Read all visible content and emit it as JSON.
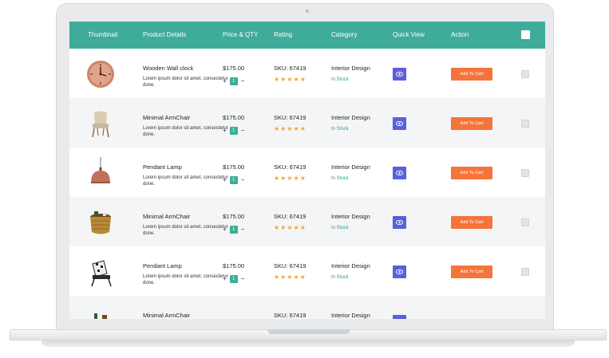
{
  "header": {
    "thumbnail": "Thumbnail",
    "product_details": "Product Details",
    "price_qty": "Price & QTY",
    "rating": "Rating",
    "category": "Category",
    "quick_view": "Quick View",
    "action": "Action"
  },
  "rows": [
    {
      "name": "Wooden Wall clock",
      "desc": "Lorem ipsum dolor sit amet, consectetur done.",
      "price": "$175.00",
      "qty": "1",
      "sku": "SKU: 67419",
      "stars": "★★★★★",
      "category": "Interior Design",
      "stock": "In Stock",
      "cart": "Add To Cart",
      "thumb_icon": "wall-clock-icon"
    },
    {
      "name": "Minimal ArmChair",
      "desc": "Lorem ipsum dolor sit amet, consectetur done.",
      "price": "$175.00",
      "qty": "1",
      "sku": "SKU: 67419",
      "stars": "★★★★★",
      "category": "Interior Design",
      "stock": "In Stock",
      "cart": "Add To Cart",
      "thumb_icon": "armchair-icon"
    },
    {
      "name": "Pendant Lamp",
      "desc": "Lorem ipsum dolor sit amet, consectetur done.",
      "price": "$175.00",
      "qty": "1",
      "sku": "SKU: 67419",
      "stars": "★★★★★",
      "category": "Interior Design",
      "stock": "In Stock",
      "cart": "Add To Cart",
      "thumb_icon": "pendant-lamp-icon"
    },
    {
      "name": "Minimal ArmChair",
      "desc": "Lorem ipsum dolor sit amet, consectetur done.",
      "price": "$175.00",
      "qty": "1",
      "sku": "SKU: 67419",
      "stars": "★★★★★",
      "category": "Interior Design",
      "stock": "In Stock",
      "cart": "Add To Cart",
      "thumb_icon": "wicker-chair-icon"
    },
    {
      "name": "Pendant Lamp",
      "desc": "Lorem ipsum dolor sit amet, consectetur done.",
      "price": "$175.00",
      "qty": "1",
      "sku": "SKU: 67419",
      "stars": "★★★★★",
      "category": "Interior Design",
      "stock": "In Stock",
      "cart": "Add To Cart",
      "thumb_icon": "lounge-chair-icon"
    },
    {
      "name": "Minimal ArmChair",
      "desc": "",
      "price": "",
      "qty": "",
      "sku": "SKU: 67419",
      "stars": "",
      "category": "Interior Design",
      "stock": "",
      "cart": "",
      "thumb_icon": "plant-chair-icon"
    }
  ],
  "qty_controls": {
    "plus": "+",
    "minus": "−"
  },
  "colors": {
    "header": "#3fac99",
    "quick_view": "#5b5fdc",
    "add_to_cart": "#f4743b",
    "stars": "#f3a533",
    "in_stock": "#2e9c82"
  }
}
